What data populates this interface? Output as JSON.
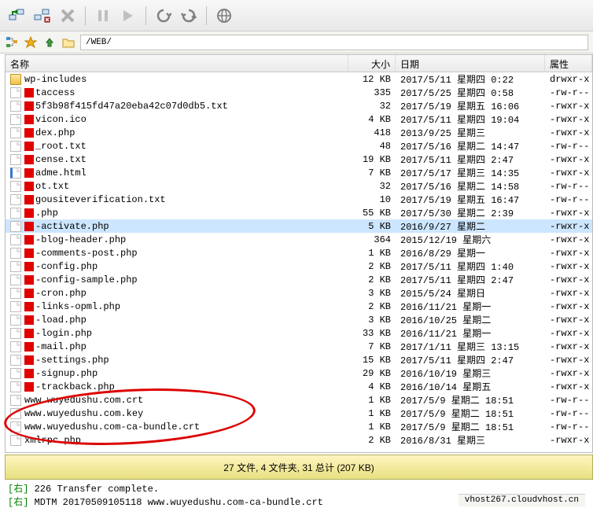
{
  "path": {
    "value": "/WEB/"
  },
  "columns": {
    "name": "名称",
    "size": "大小",
    "date": "日期",
    "attr": "属性"
  },
  "files": [
    {
      "icon": "folder",
      "red": false,
      "name": "wp-includes",
      "size": "12 KB",
      "date": "2017/5/11 星期四 0:22",
      "attr": "drwxr-x"
    },
    {
      "icon": "file",
      "red": true,
      "name": "taccess",
      "size": "335",
      "date": "2017/5/25 星期四 0:58",
      "attr": "-rw-r--"
    },
    {
      "icon": "file",
      "red": true,
      "name": "5f3b98f415fd47a20eba42c07d0db5.txt",
      "size": "32",
      "date": "2017/5/19 星期五 16:06",
      "attr": "-rwxr-x"
    },
    {
      "icon": "file",
      "red": true,
      "name": "vicon.ico",
      "size": "4 KB",
      "date": "2017/5/11 星期四 19:04",
      "attr": "-rwxr-x"
    },
    {
      "icon": "file",
      "red": true,
      "name": "dex.php",
      "size": "418",
      "date": "2013/9/25 星期三",
      "attr": "-rwxr-x"
    },
    {
      "icon": "file",
      "red": true,
      "name": "_root.txt",
      "size": "48",
      "date": "2017/5/16 星期二 14:47",
      "attr": "-rw-r--"
    },
    {
      "icon": "file",
      "red": true,
      "name": "cense.txt",
      "size": "19 KB",
      "date": "2017/5/11 星期四 2:47",
      "attr": "-rwxr-x"
    },
    {
      "icon": "html",
      "red": true,
      "name": "adme.html",
      "size": "7 KB",
      "date": "2017/5/17 星期三 14:35",
      "attr": "-rwxr-x"
    },
    {
      "icon": "file",
      "red": true,
      "name": "ot.txt",
      "size": "32",
      "date": "2017/5/16 星期二 14:58",
      "attr": "-rw-r--"
    },
    {
      "icon": "file",
      "red": true,
      "name": "gousiteverification.txt",
      "size": "10",
      "date": "2017/5/19 星期五 16:47",
      "attr": "-rw-r--"
    },
    {
      "icon": "file",
      "red": true,
      "name": ".php",
      "size": "55 KB",
      "date": "2017/5/30 星期二 2:39",
      "attr": "-rwxr-x"
    },
    {
      "icon": "file",
      "red": true,
      "name": "-activate.php",
      "size": "5 KB",
      "date": "2016/9/27 星期二",
      "attr": "-rwxr-x",
      "sel": true
    },
    {
      "icon": "file",
      "red": true,
      "name": "-blog-header.php",
      "size": "364",
      "date": "2015/12/19 星期六",
      "attr": "-rwxr-x"
    },
    {
      "icon": "file",
      "red": true,
      "name": "-comments-post.php",
      "size": "1 KB",
      "date": "2016/8/29 星期一",
      "attr": "-rwxr-x"
    },
    {
      "icon": "file",
      "red": true,
      "name": "-config.php",
      "size": "2 KB",
      "date": "2017/5/11 星期四 1:40",
      "attr": "-rwxr-x"
    },
    {
      "icon": "file",
      "red": true,
      "name": "-config-sample.php",
      "size": "2 KB",
      "date": "2017/5/11 星期四 2:47",
      "attr": "-rwxr-x"
    },
    {
      "icon": "file",
      "red": true,
      "name": "-cron.php",
      "size": "3 KB",
      "date": "2015/5/24 星期日",
      "attr": "-rwxr-x"
    },
    {
      "icon": "file",
      "red": true,
      "name": "-links-opml.php",
      "size": "2 KB",
      "date": "2016/11/21 星期一",
      "attr": "-rwxr-x"
    },
    {
      "icon": "file",
      "red": true,
      "name": "-load.php",
      "size": "3 KB",
      "date": "2016/10/25 星期二",
      "attr": "-rwxr-x"
    },
    {
      "icon": "file",
      "red": true,
      "name": "-login.php",
      "size": "33 KB",
      "date": "2016/11/21 星期一",
      "attr": "-rwxr-x"
    },
    {
      "icon": "file",
      "red": true,
      "name": "-mail.php",
      "size": "7 KB",
      "date": "2017/1/11 星期三 13:15",
      "attr": "-rwxr-x"
    },
    {
      "icon": "file",
      "red": true,
      "name": "-settings.php",
      "size": "15 KB",
      "date": "2017/5/11 星期四 2:47",
      "attr": "-rwxr-x"
    },
    {
      "icon": "file",
      "red": true,
      "name": "-signup.php",
      "size": "29 KB",
      "date": "2016/10/19 星期三",
      "attr": "-rwxr-x"
    },
    {
      "icon": "file",
      "red": true,
      "name": "-trackback.php",
      "size": "4 KB",
      "date": "2016/10/14 星期五",
      "attr": "-rwxr-x"
    },
    {
      "icon": "file",
      "red": false,
      "name": "www.wuyedushu.com.crt",
      "size": "1 KB",
      "date": "2017/5/9 星期二 18:51",
      "attr": "-rw-r--",
      "strike": true
    },
    {
      "icon": "file",
      "red": false,
      "name": "www.wuyedushu.com.key",
      "size": "1 KB",
      "date": "2017/5/9 星期二 18:51",
      "attr": "-rw-r--",
      "strike": true
    },
    {
      "icon": "file",
      "red": false,
      "name": "www.wuyedushu.com-ca-bundle.crt",
      "size": "1 KB",
      "date": "2017/5/9 星期二 18:51",
      "attr": "-rw-r--",
      "strike": true
    },
    {
      "icon": "file",
      "red": false,
      "name": "xmlrpc.php",
      "size": "2 KB",
      "date": "2016/8/31 星期三",
      "attr": "-rwxr-x"
    }
  ],
  "status": "27 文件, 4 文件夹, 31 总计 (207 KB)",
  "log": {
    "line1_prefix": "[右]",
    "line1": " 226 Transfer complete.",
    "line2_prefix": "[右]",
    "line2": " MDTM 20170509105118 www.wuyedushu.com-ca-bundle.crt"
  },
  "host": "vhost267.cloudvhost.cn"
}
